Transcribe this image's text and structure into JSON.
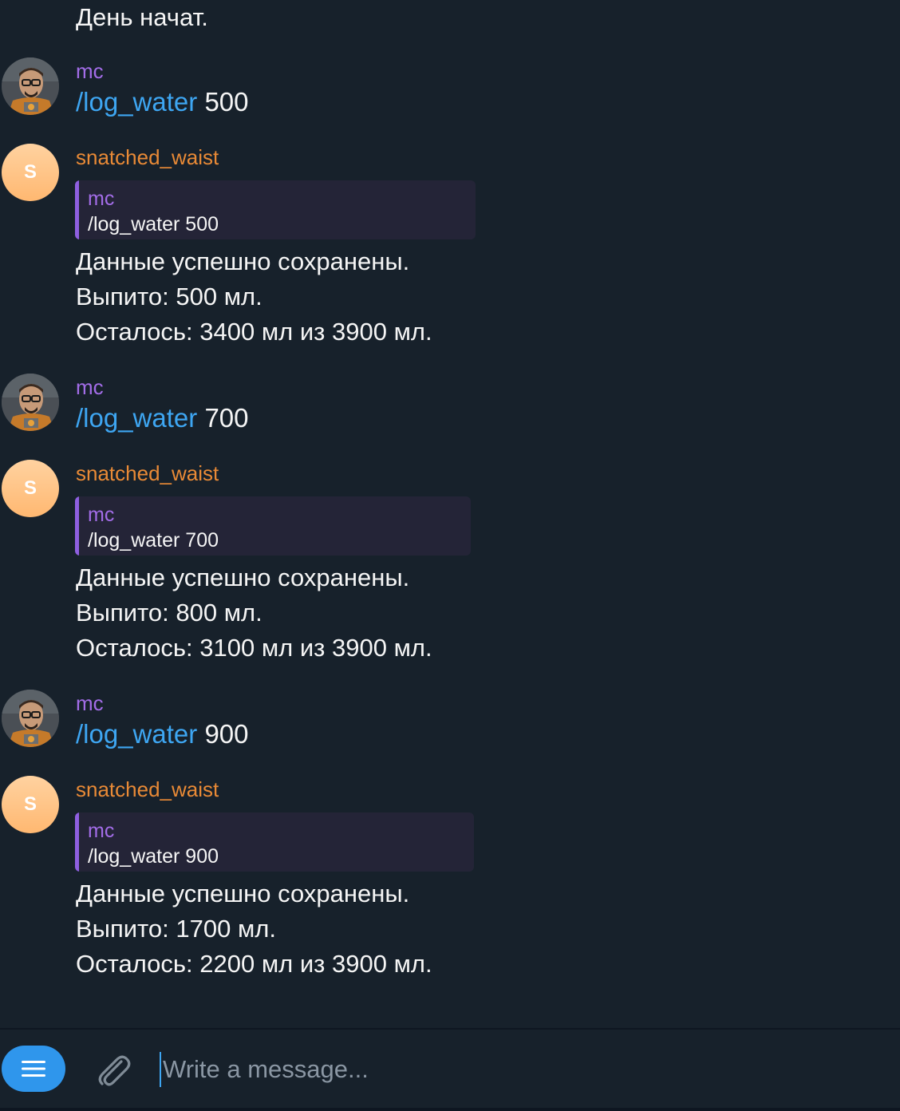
{
  "chat": {
    "top_text": "День начат.",
    "messages": [
      {
        "user_name": "mc",
        "command": "/log_water",
        "arg": "500",
        "bot_name": "snatched_waist",
        "bot_avatar_letter": "S",
        "quote_name": "mc",
        "quote_text": "/log_water 500",
        "reply_lines": [
          "Данные успешно сохранены.",
          "Выпито: 500 мл.",
          "Осталось: 3400 мл из 3900 мл."
        ]
      },
      {
        "user_name": "mc",
        "command": "/log_water",
        "arg": "700",
        "bot_name": "snatched_waist",
        "bot_avatar_letter": "S",
        "quote_name": "mc",
        "quote_text": "/log_water 700",
        "reply_lines": [
          "Данные успешно сохранены.",
          "Выпито: 800 мл.",
          "Осталось: 3100 мл из 3900 мл."
        ]
      },
      {
        "user_name": "mc",
        "command": "/log_water",
        "arg": "900",
        "bot_name": "snatched_waist",
        "bot_avatar_letter": "S",
        "quote_name": "mc",
        "quote_text": "/log_water 900",
        "reply_lines": [
          "Данные успешно сохранены.",
          "Выпито: 1700 мл.",
          "Осталось: 2200 мл из 3900 мл."
        ]
      }
    ]
  },
  "composer": {
    "placeholder": "Write a message...",
    "menu_icon": "menu-icon",
    "attach_icon": "paperclip-icon"
  },
  "colors": {
    "background": "#17212b",
    "user_name": "#a36de8",
    "bot_name": "#e98a36",
    "command_link": "#3ea6f2",
    "quote_bg": "#242437",
    "quote_bar": "#8e5fe0",
    "menu_button": "#2f96ec"
  }
}
